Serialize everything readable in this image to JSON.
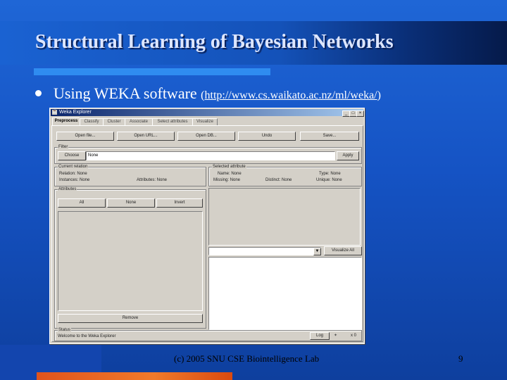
{
  "slide": {
    "title": "Structural Learning of Bayesian Networks",
    "bullet_text": "Using WEKA software",
    "link_open": "(",
    "link_url": "http://www.cs.waikato.ac.nz/ml/weka/",
    "link_close": ")",
    "footer": "(c) 2005 SNU CSE Biointelligence Lab",
    "page_number": "9"
  },
  "weka": {
    "window_title": "Weka Explorer",
    "tabs": [
      "Preprocess",
      "Classify",
      "Cluster",
      "Associate",
      "Select attributes",
      "Visualize"
    ],
    "buttons": {
      "open_file": "Open file...",
      "open_url": "Open URL...",
      "open_db": "Open DB...",
      "undo": "Undo",
      "save": "Save..."
    },
    "filter": {
      "label": "Filter",
      "choose": "Choose",
      "value": "None",
      "apply": "Apply"
    },
    "current_relation": {
      "label": "Current relation",
      "relation": "Relation: None",
      "instances": "Instances: None",
      "attributes": "Attributes: None"
    },
    "attributes": {
      "label": "Attributes",
      "all": "All",
      "none": "None",
      "invert": "Invert",
      "remove": "Remove"
    },
    "selected_attribute": {
      "label": "Selected attribute",
      "name": "Name: None",
      "type": "Type: None",
      "missing": "Missing: None",
      "distinct": "Distinct: None",
      "unique": "Unique: None",
      "visualize_all": "Visualize All"
    },
    "status": {
      "label": "Status",
      "message": "Welcome to the Weka Explorer",
      "log": "Log",
      "count": "x 0"
    },
    "controls": {
      "close": "×",
      "maximize": "□",
      "minimize": "_",
      "dropdown": "▼"
    }
  }
}
